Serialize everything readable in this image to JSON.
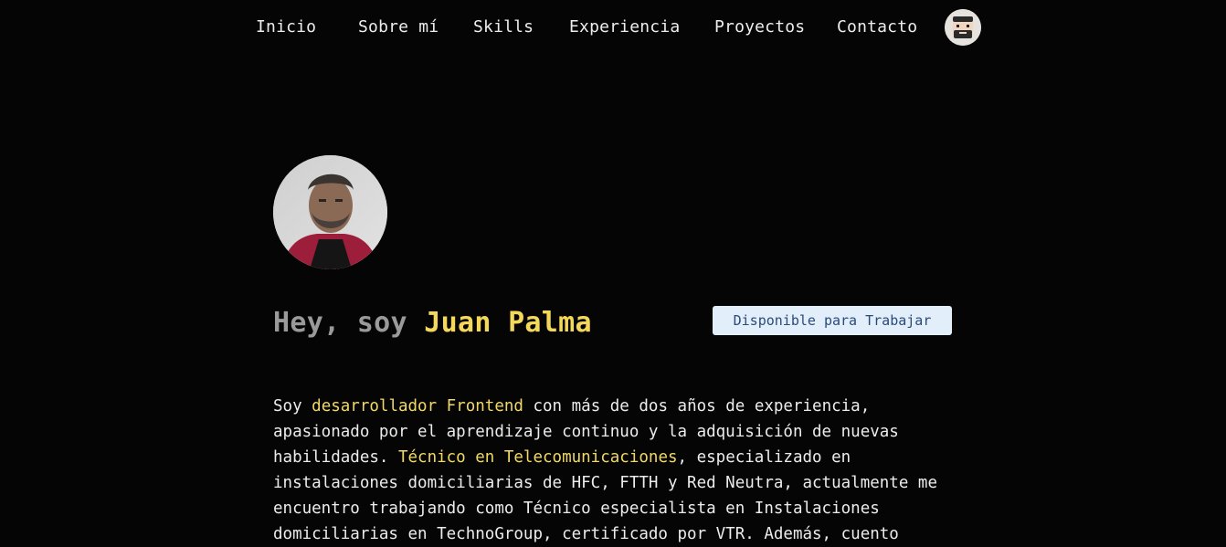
{
  "nav": {
    "items": [
      {
        "label": "Inicio"
      },
      {
        "label": "Sobre mí"
      },
      {
        "label": "Skills"
      },
      {
        "label": "Experiencia"
      },
      {
        "label": "Proyectos"
      },
      {
        "label": "Contacto"
      }
    ],
    "avatar_icon": "cartoon-face-avatar-icon"
  },
  "hero": {
    "photo": "profile-photo",
    "greeting": "Hey, soy ",
    "name": "Juan Palma",
    "badge": "Disponible para Trabajar"
  },
  "bio": {
    "t1": "Soy ",
    "h1": "desarrollador Frontend",
    "t2": " con más de dos años de experiencia, apasionado por el aprendizaje continuo y la adquisición de nuevas habilidades. ",
    "h2": "Técnico en Telecomunicaciones",
    "t3": ", especializado en instalaciones domiciliarias de HFC, FTTH y Red Neutra, actualmente me encuentro trabajando como Técnico especialista en Instalaciones domiciliarias en TechnoGroup, certificado por VTR. Además, cuento"
  },
  "colors": {
    "background": "#050505",
    "accent": "#f4d85a",
    "badge_bg": "#e3eefb",
    "badge_text": "#2a4a7a"
  }
}
